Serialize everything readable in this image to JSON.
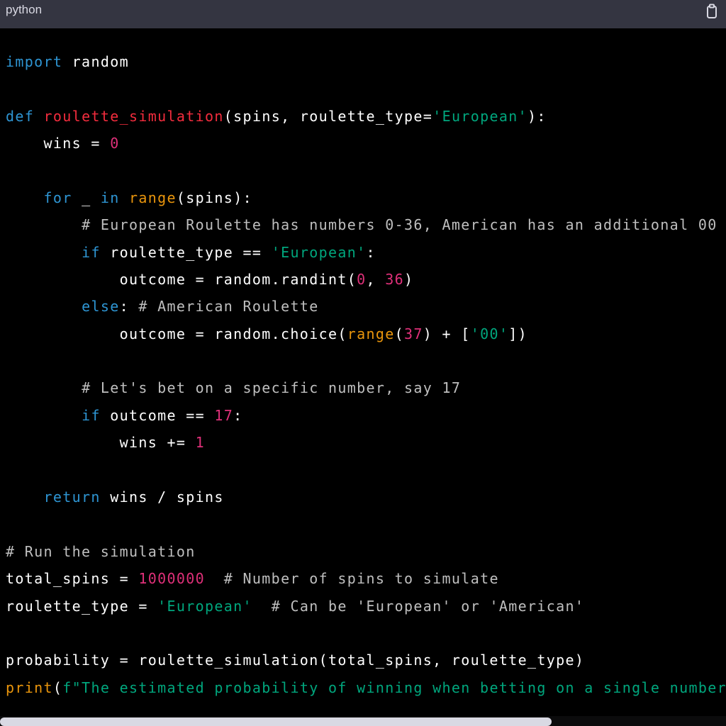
{
  "header": {
    "language": "python",
    "copy_icon": "clipboard-icon"
  },
  "code": {
    "line1": {
      "t1": "import",
      "t2": " random"
    },
    "line2": {
      "t1": "def",
      "t2": " ",
      "t3": "roulette_simulation",
      "t4": "(spins, roulette_type=",
      "t5": "'European'",
      "t6": "):"
    },
    "line3": {
      "t1": "    wins = ",
      "t2": "0"
    },
    "line4": {
      "t1": "    ",
      "t2": "for",
      "t3": " _ ",
      "t4": "in",
      "t5": " ",
      "t6": "range",
      "t7": "(spins):"
    },
    "line5": {
      "t1": "        ",
      "t2": "# European Roulette has numbers 0-36, American has an additional 00"
    },
    "line6": {
      "t1": "        ",
      "t2": "if",
      "t3": " roulette_type == ",
      "t4": "'European'",
      "t5": ":"
    },
    "line7": {
      "t1": "            outcome = random.randint(",
      "t2": "0",
      "t3": ", ",
      "t4": "36",
      "t5": ")"
    },
    "line8": {
      "t1": "        ",
      "t2": "else",
      "t3": ": ",
      "t4": "# American Roulette"
    },
    "line9": {
      "t1": "            outcome = random.choice(",
      "t2": "range",
      "t3": "(",
      "t4": "37",
      "t5": ") + [",
      "t6": "'00'",
      "t7": "])"
    },
    "line10": {
      "t1": "        ",
      "t2": "# Let's bet on a specific number, say 17"
    },
    "line11": {
      "t1": "        ",
      "t2": "if",
      "t3": " outcome == ",
      "t4": "17",
      "t5": ":"
    },
    "line12": {
      "t1": "            wins += ",
      "t2": "1"
    },
    "line13": {
      "t1": "    ",
      "t2": "return",
      "t3": " wins / spins"
    },
    "line14": {
      "t1": "# Run the simulation"
    },
    "line15": {
      "t1": "total_spins = ",
      "t2": "1000000",
      "t3": "  ",
      "t4": "# Number of spins to simulate"
    },
    "line16": {
      "t1": "roulette_type = ",
      "t2": "'European'",
      "t3": "  ",
      "t4": "# Can be 'European' or 'American'"
    },
    "line17": {
      "t1": "probability = roulette_simulation(total_spins, roulette_type)"
    },
    "line18": {
      "t1": "print",
      "t2": "(",
      "t3": "f\"The estimated probability of winning when betting on a single number"
    }
  },
  "scroll": {
    "horizontal_position": 0.0,
    "visible_fraction": 0.76
  },
  "colors": {
    "keyword": "#2e95d3",
    "function_name": "#f22c3d",
    "string": "#00a67d",
    "number": "#df3079",
    "comment": "#bfbfbf",
    "builtin": "#e9950c",
    "header_bg": "#343541"
  }
}
